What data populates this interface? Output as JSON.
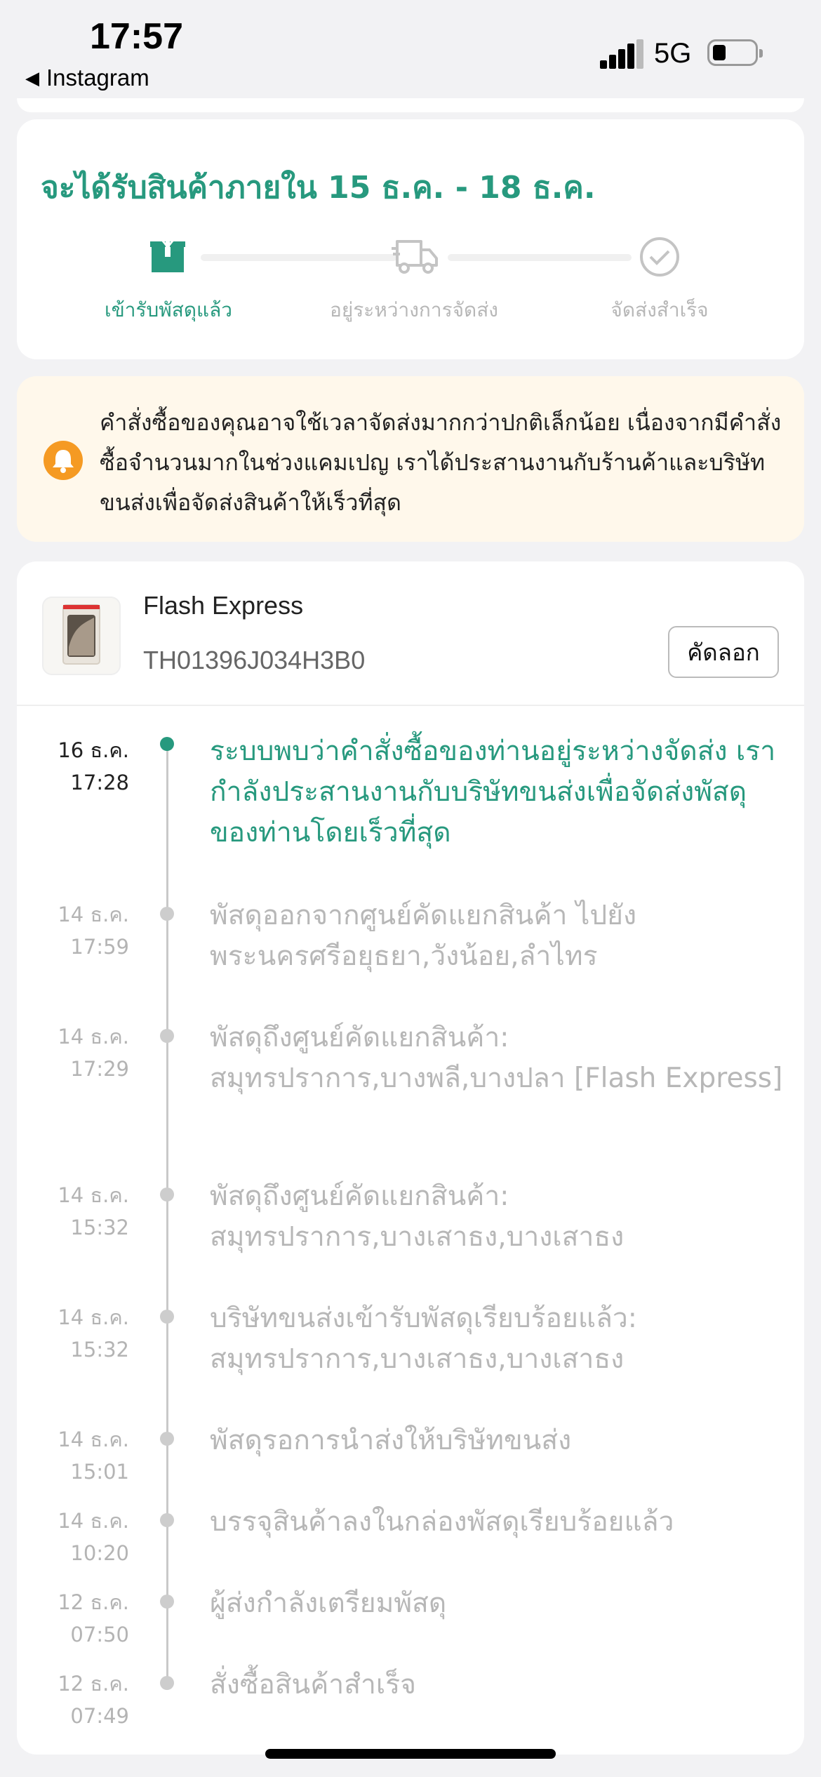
{
  "status_bar": {
    "time": "17:57",
    "back_app": "Instagram",
    "network": "5G"
  },
  "delivery": {
    "estimate_title": "จะได้รับสินค้าภายใน 15 ธ.ค. - 18 ธ.ค.",
    "steps": [
      {
        "label": "เข้ารับพัสดุแล้ว",
        "icon": "package-icon",
        "active": true
      },
      {
        "label": "อยู่ระหว่างการจัดส่ง",
        "icon": "truck-icon",
        "active": false
      },
      {
        "label": "จัดส่งสำเร็จ",
        "icon": "check-circle-icon",
        "active": false
      }
    ],
    "accent_color": "#27997e"
  },
  "notice": {
    "icon": "bell-icon",
    "text": "คำสั่งซื้อของคุณอาจใช้เวลาจัดส่งมากกว่าปกติเล็กน้อย เนื่องจากมีคำสั่งซื้อจำนวนมากในช่วงแคมเปญ เราได้ประสานงานกับร้านค้าและบริษัทขนส่งเพื่อจัดส่งสินค้าให้เร็วที่สุด",
    "color": "#f59a23"
  },
  "shipment": {
    "carrier": "Flash Express",
    "tracking_number": "TH01396J034H3B0",
    "copy_label": "คัดลอก"
  },
  "timeline": [
    {
      "date": "16 ธ.ค.",
      "time": "17:28",
      "text": "ระบบพบว่าคำสั่งซื้อของท่านอยู่ระหว่างจัดส่ง เรากำลังประสานงานกับบริษัทขนส่งเพื่อจัดส่งพัสดุของท่านโดยเร็วที่สุด"
    },
    {
      "date": "14 ธ.ค.",
      "time": "17:59",
      "text": "พัสดุออกจากศูนย์คัดแยกสินค้า ไปยัง พระนครศรีอยุธยา,วังน้อย,ลำไทร"
    },
    {
      "date": "14 ธ.ค.",
      "time": "17:29",
      "text": "พัสดุถึงศูนย์คัดแยกสินค้า: สมุทรปราการ,บางพลี,บางปลา  [Flash Express]"
    },
    {
      "date": "14 ธ.ค.",
      "time": "15:32",
      "text": "พัสดุถึงศูนย์คัดแยกสินค้า: สมุทรปราการ,บางเสาธง,บางเสาธง"
    },
    {
      "date": "14 ธ.ค.",
      "time": "15:32",
      "text": "บริษัทขนส่งเข้ารับพัสดุเรียบร้อยแล้ว: สมุทรปราการ,บางเสาธง,บางเสาธง"
    },
    {
      "date": "14 ธ.ค.",
      "time": "15:01",
      "text": "พัสดุรอการนำส่งให้บริษัทขนส่ง"
    },
    {
      "date": "14 ธ.ค.",
      "time": "10:20",
      "text": "บรรจุสินค้าลงในกล่องพัสดุเรียบร้อยแล้ว"
    },
    {
      "date": "12 ธ.ค.",
      "time": "07:50",
      "text": " ผู้ส่งกำลังเตรียมพัสดุ"
    },
    {
      "date": "12 ธ.ค.",
      "time": "07:49",
      "text": "สั่งซื้อสินค้าสำเร็จ"
    }
  ]
}
